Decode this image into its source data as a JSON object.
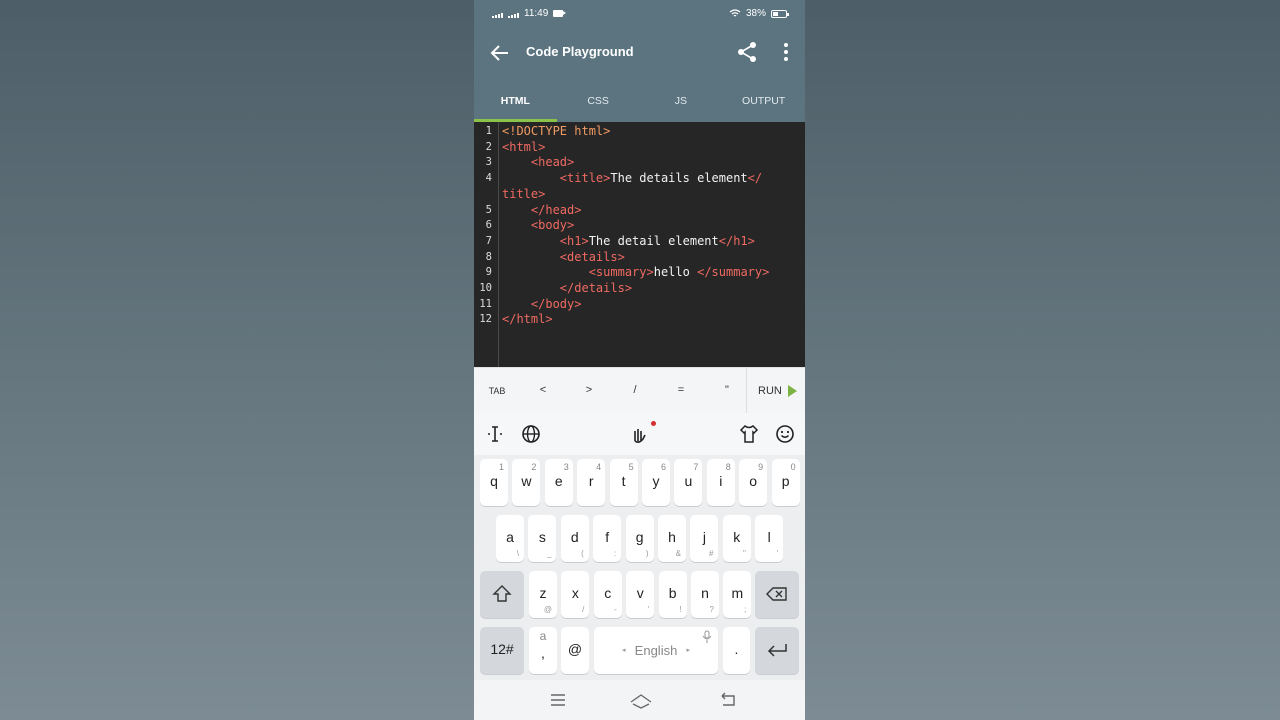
{
  "status_bar": {
    "time": "11:49",
    "battery": "38%",
    "battery_level": 0.38
  },
  "app_bar": {
    "title": "Code Playground"
  },
  "tabs": [
    {
      "label": "HTML",
      "active": true
    },
    {
      "label": "CSS",
      "active": false
    },
    {
      "label": "JS",
      "active": false
    },
    {
      "label": "OUTPUT",
      "active": false
    }
  ],
  "editor": {
    "line_numbers": [
      "1",
      "2",
      "3",
      "4",
      "",
      "5",
      "6",
      "7",
      "8",
      "9",
      "10",
      "11",
      "12"
    ],
    "lines": [
      [
        {
          "t": "<!DOCTYPE html>",
          "c": "dt"
        }
      ],
      [
        {
          "t": "<html>",
          "c": "tag"
        }
      ],
      [
        {
          "t": "    "
        },
        {
          "t": "<head>",
          "c": "tag"
        }
      ],
      [
        {
          "t": "        "
        },
        {
          "t": "<title>",
          "c": "tag"
        },
        {
          "t": "The details element"
        },
        {
          "t": "</",
          "c": "tag"
        }
      ],
      [
        {
          "t": "title>",
          "c": "tag"
        }
      ],
      [
        {
          "t": "    "
        },
        {
          "t": "</head>",
          "c": "tag"
        }
      ],
      [
        {
          "t": "    "
        },
        {
          "t": "<body>",
          "c": "tag"
        }
      ],
      [
        {
          "t": "        "
        },
        {
          "t": "<h1>",
          "c": "tag"
        },
        {
          "t": "The detail element"
        },
        {
          "t": "</h1>",
          "c": "tag"
        }
      ],
      [
        {
          "t": "        "
        },
        {
          "t": "<details>",
          "c": "tag"
        }
      ],
      [
        {
          "t": "            "
        },
        {
          "t": "<summary>",
          "c": "tag"
        },
        {
          "t": "hello "
        },
        {
          "t": "</summary>",
          "c": "tag"
        }
      ],
      [
        {
          "t": "        "
        },
        {
          "t": "</details>",
          "c": "tag"
        }
      ],
      [
        {
          "t": "    "
        },
        {
          "t": "</body>",
          "c": "tag"
        }
      ],
      [
        {
          "t": "</html>",
          "c": "tag"
        }
      ]
    ]
  },
  "accessory_keys": [
    "TAB",
    "<",
    ">",
    "/",
    "=",
    "\""
  ],
  "run_label": "RUN",
  "keyboard": {
    "row1": [
      {
        "k": "q",
        "s": "1"
      },
      {
        "k": "w",
        "s": "2"
      },
      {
        "k": "e",
        "s": "3"
      },
      {
        "k": "r",
        "s": "4"
      },
      {
        "k": "t",
        "s": "5"
      },
      {
        "k": "y",
        "s": "6"
      },
      {
        "k": "u",
        "s": "7"
      },
      {
        "k": "i",
        "s": "8"
      },
      {
        "k": "o",
        "s": "9"
      },
      {
        "k": "p",
        "s": "0"
      }
    ],
    "row2": [
      {
        "k": "a",
        "s": "\\"
      },
      {
        "k": "s",
        "s": "_"
      },
      {
        "k": "d",
        "s": "("
      },
      {
        "k": "f",
        "s": ":"
      },
      {
        "k": "g",
        "s": ")"
      },
      {
        "k": "h",
        "s": "&"
      },
      {
        "k": "j",
        "s": "#"
      },
      {
        "k": "k",
        "s": "\""
      },
      {
        "k": "l",
        "s": "'"
      }
    ],
    "row3": [
      {
        "k": "z",
        "s": "@"
      },
      {
        "k": "x",
        "s": "/"
      },
      {
        "k": "c",
        "s": "-"
      },
      {
        "k": "v",
        "s": "'"
      },
      {
        "k": "b",
        "s": "!"
      },
      {
        "k": "n",
        "s": "?"
      },
      {
        "k": "m",
        "s": ";"
      }
    ],
    "symbols_label": "12#",
    "comma_top": "a",
    "comma_label": ",",
    "at_label": "@",
    "space_label": "English",
    "period_label": "."
  }
}
